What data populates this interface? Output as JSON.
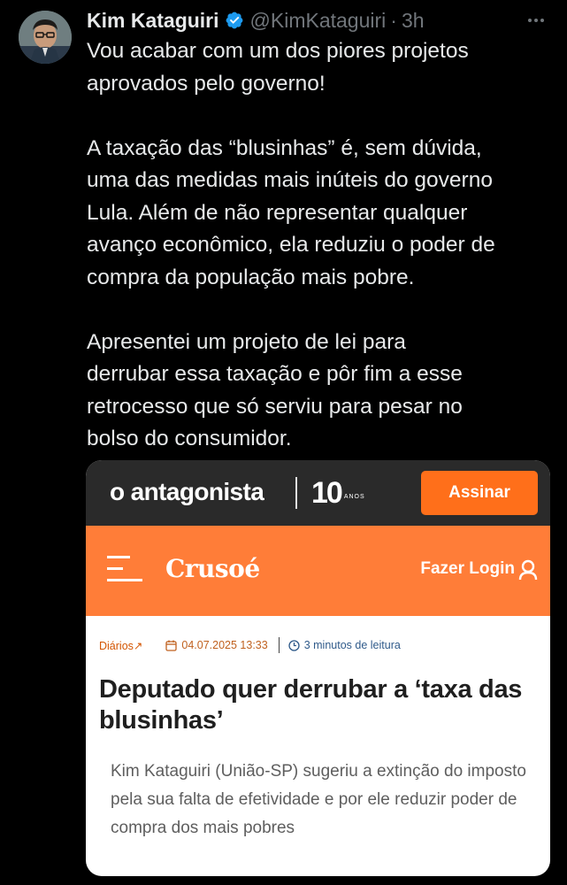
{
  "tweet": {
    "author_name": "Kim Kataguiri",
    "handle": "@KimKataguiri",
    "separator": "·",
    "time": "3h",
    "paragraphs": [
      [
        "Vou acabar com um dos piores projetos",
        "aprovados pelo governo!"
      ],
      [
        "A taxação das “blusinhas” é, sem dúvida,",
        "uma das medidas mais inúteis do governo",
        "Lula. Além de não representar qualquer",
        "avanço econômico, ela reduziu o poder de",
        "compra da população mais pobre."
      ],
      [
        "Apresentei um projeto de lei para",
        "derrubar essa taxação e pôr fim a esse",
        "retrocesso que só serviu para pesar no",
        "bolso do consumidor."
      ]
    ]
  },
  "card": {
    "site_logo": "o antagonista",
    "anniversary": "10",
    "anniversary_label": "ANOS",
    "subscribe_label": "Assinar",
    "brand": "Crusoé",
    "login_label": "Fazer Login",
    "section": "Diários",
    "section_arrow": "↗",
    "date": "04.07.2025 13:33",
    "read_time": "3 minutos de leitura",
    "title": "Deputado quer derrubar a ‘taxa das blusinhas’",
    "summary": "Kim Kataguiri (União-SP) sugeriu a extinção do imposto pela sua falta de efetividade e por ele reduzir poder de compra dos mais pobres"
  },
  "colors": {
    "background": "#000000",
    "text": "#e7e9ea",
    "muted": "#71767b",
    "verified": "#1d9bf0",
    "accent_orange": "#ff6f1a",
    "nav_orange": "#ff7d38",
    "site_bar": "#2a2a2a"
  },
  "icons": {
    "verified": "verified-badge-icon",
    "more": "more-horizontal-icon",
    "menu": "hamburger-menu-icon",
    "user": "user-icon",
    "calendar": "calendar-icon",
    "clock": "clock-icon"
  }
}
